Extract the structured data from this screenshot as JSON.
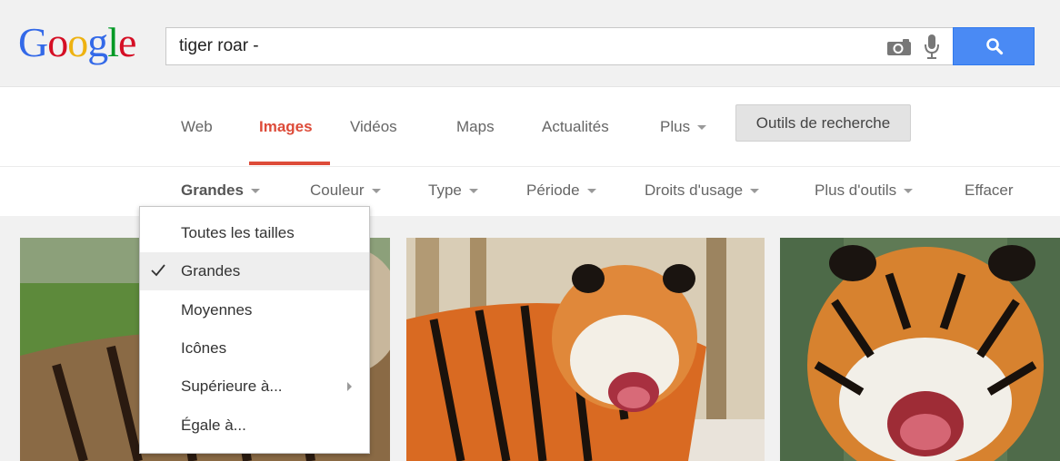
{
  "logo": {
    "letters": [
      "G",
      "o",
      "o",
      "g",
      "l",
      "e"
    ],
    "colors": [
      "#3369e8",
      "#d50f25",
      "#eeb211",
      "#3369e8",
      "#009925",
      "#d50f25"
    ]
  },
  "search": {
    "query": "tiger roar -"
  },
  "nav": {
    "tabs": [
      {
        "label": "Web"
      },
      {
        "label": "Images",
        "active": true
      },
      {
        "label": "Vidéos"
      },
      {
        "label": "Maps"
      },
      {
        "label": "Actualités"
      },
      {
        "label": "Plus"
      }
    ],
    "tools_button": "Outils de recherche"
  },
  "tools": {
    "items": [
      {
        "label": "Grandes",
        "active": true
      },
      {
        "label": "Couleur"
      },
      {
        "label": "Type"
      },
      {
        "label": "Période"
      },
      {
        "label": "Droits d'usage"
      },
      {
        "label": "Plus d'outils"
      }
    ],
    "clear": "Effacer"
  },
  "size_menu": {
    "items": [
      {
        "label": "Toutes les tailles"
      },
      {
        "label": "Grandes",
        "selected": true
      },
      {
        "label": "Moyennes"
      },
      {
        "label": "Icônes"
      },
      {
        "label": "Supérieure à...",
        "submenu": true
      },
      {
        "label": "Égale à..."
      }
    ]
  },
  "colors": {
    "accent_red": "#dd4b39",
    "search_blue": "#4a8af4"
  }
}
